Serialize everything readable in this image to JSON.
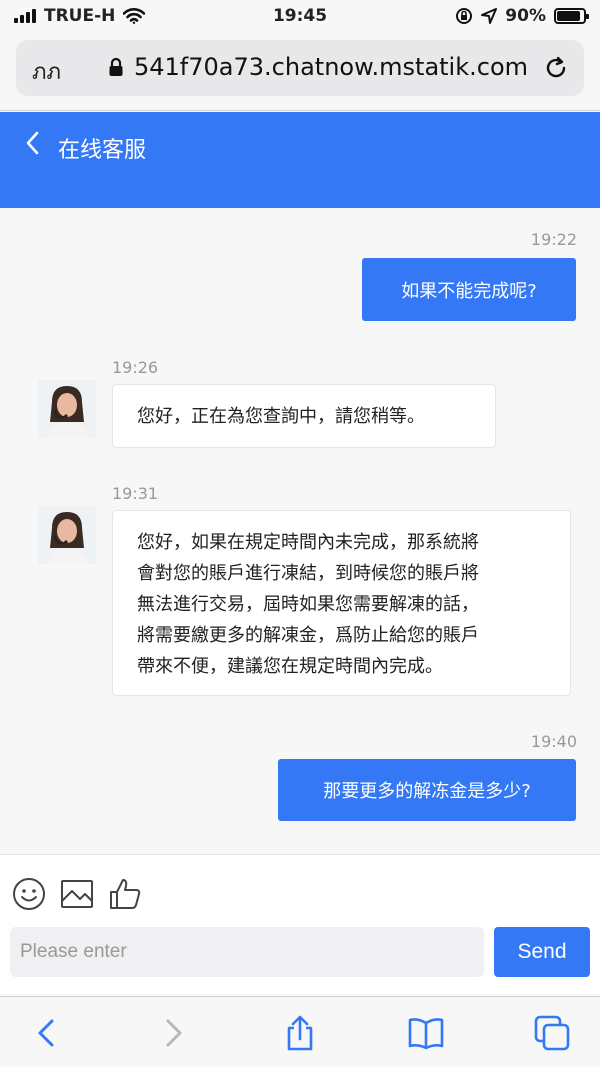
{
  "status_bar": {
    "carrier": "TRUE-H",
    "time": "19:45",
    "battery_text": "90%",
    "battery_level": 0.9
  },
  "browser": {
    "reader_label": "ภภ",
    "url": "541f70a73.chatnow.mstatik.com"
  },
  "header": {
    "title": "在线客服"
  },
  "messages": [
    {
      "direction": "outgoing",
      "time": "19:22",
      "text": "如果不能完成呢?"
    },
    {
      "direction": "incoming",
      "time": "19:26",
      "lines": [
        "您好，正在為您查詢中，請您稍等。"
      ]
    },
    {
      "direction": "incoming",
      "time": "19:31",
      "lines": [
        "您好，如果在規定時間內未完成，那系統將",
        "會對您的賬戶進行凍結，到時候您的賬戶將",
        "無法進行交易，屆時如果您需要解凍的話，",
        "將需要繳更多的解凍金，爲防止給您的賬戶",
        "帶來不便，建議您在規定時間內完成。"
      ]
    },
    {
      "direction": "outgoing",
      "time": "19:40",
      "text": "那要更多的解冻金是多少?"
    }
  ],
  "composer": {
    "placeholder": "Please enter",
    "send_label": "Send",
    "tools": [
      "emoji-icon",
      "image-icon",
      "thumbs-up-icon"
    ]
  },
  "toolbar": {
    "icons": [
      "back-icon",
      "forward-icon",
      "share-icon",
      "bookmarks-icon",
      "tabs-icon"
    ]
  },
  "colors": {
    "accent": "#3478f6",
    "background": "#f7f7f7"
  }
}
